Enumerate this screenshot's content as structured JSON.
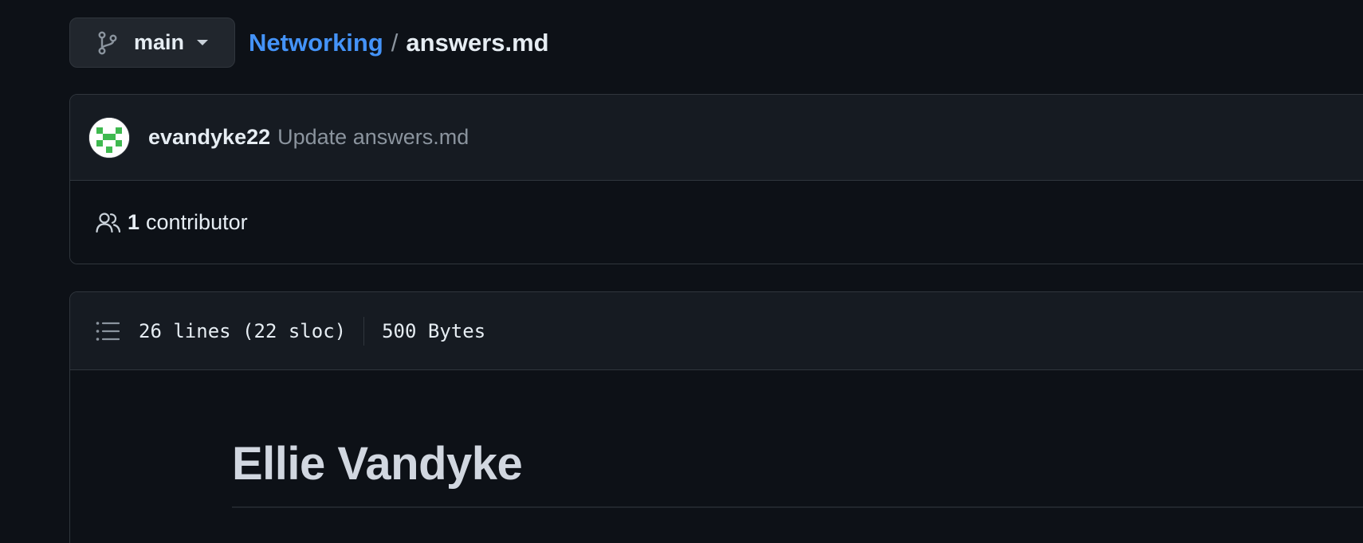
{
  "branch": {
    "icon": "git-branch-icon",
    "label": "main"
  },
  "breadcrumb": {
    "repo": "Networking",
    "separator": "/",
    "file": "answers.md"
  },
  "commit": {
    "author": "evandyke22",
    "message": "Update answers.md",
    "avatar_colors": [
      "#ffffff",
      "#3fb950"
    ]
  },
  "contributors": {
    "icon": "people-icon",
    "count": "1",
    "label": "contributor"
  },
  "file": {
    "lines_info": "26 lines (22 sloc)",
    "size": "500 Bytes"
  },
  "readme": {
    "heading": "Ellie Vandyke"
  },
  "colors": {
    "background": "#0d1117",
    "panel": "#161b22",
    "border": "#30363d",
    "link": "#4493f8",
    "muted": "#8b949e"
  }
}
